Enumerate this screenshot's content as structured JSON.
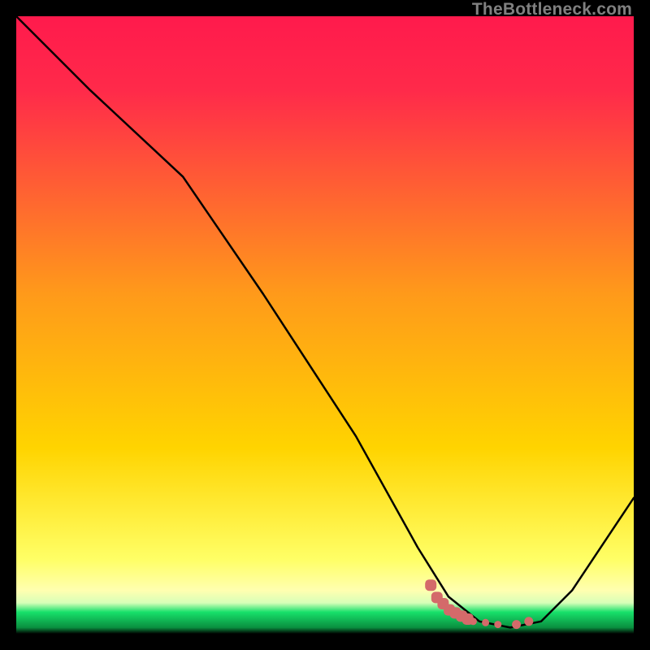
{
  "watermark": "TheBottleneck.com",
  "colors": {
    "top": "#ff1a4c",
    "mid": "#ffd400",
    "lowYellow": "#ffff8a",
    "greenBand": "#17e06a",
    "black": "#000000",
    "curve": "#000000",
    "marker": "#d46a6a"
  },
  "chart_data": {
    "type": "line",
    "title": "",
    "xlabel": "",
    "ylabel": "",
    "xlim": [
      0,
      100
    ],
    "ylim": [
      0,
      100
    ],
    "grid": false,
    "legend": false,
    "series": [
      {
        "name": "bottleneck-curve",
        "x": [
          0,
          12,
          27,
          40,
          55,
          65,
          70,
          75,
          80,
          85,
          90,
          100
        ],
        "y": [
          100,
          88,
          74,
          55,
          32,
          14,
          6,
          2,
          1,
          2,
          7,
          22
        ]
      }
    ],
    "markers": {
      "name": "sweet-spot-band",
      "x": [
        67,
        68,
        69,
        70,
        71,
        72,
        73,
        74,
        76,
        78,
        81,
        83
      ],
      "y": [
        8,
        6,
        5,
        4,
        3.5,
        3,
        2.5,
        2,
        1.8,
        1.5,
        1.5,
        2
      ]
    }
  }
}
